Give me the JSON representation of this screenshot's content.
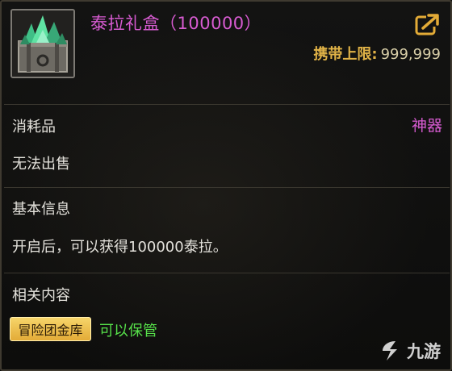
{
  "item": {
    "name": "泰拉礼盒（100000）",
    "icon": "gift-box-icon",
    "carry_limit_label": "携带上限:",
    "carry_limit_value": "999,999"
  },
  "category": {
    "type": "消耗品",
    "grade": "神器",
    "trade_status": "无法出售"
  },
  "basic_info": {
    "header": "基本信息",
    "description": "开启后，可以获得100000泰拉。"
  },
  "related": {
    "header": "相关内容",
    "storage_chip": "冒险团金库",
    "storable_text": "可以保管"
  },
  "watermark": {
    "text": "九游"
  },
  "colors": {
    "title_purple": "#d75bd1",
    "limit_gold": "#e0b247",
    "storable_green": "#56e04a",
    "chip_gold": "#f0c24e"
  }
}
